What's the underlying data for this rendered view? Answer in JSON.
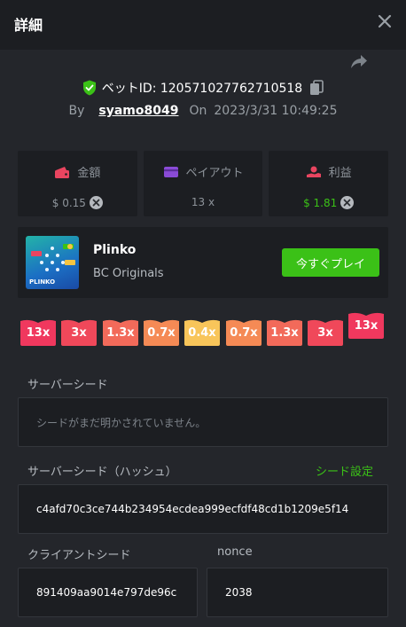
{
  "header": {
    "title": "詳細"
  },
  "bet": {
    "id_label": "ベットID: 120571027762710518",
    "by_label": "By",
    "user": "syamo8049",
    "on_label": "On",
    "date": "2023/3/31 10:49:25"
  },
  "stats": [
    {
      "label": "金額",
      "value": "$ 0.15",
      "icon": "wallet-icon",
      "color": "#e94560"
    },
    {
      "label": "ペイアウト",
      "value": "13 x",
      "icon": "card-icon",
      "color": "#8a4bd6"
    },
    {
      "label": "利益",
      "value": "$ 1.81",
      "icon": "hand-coin-icon",
      "color": "#e94560"
    }
  ],
  "game": {
    "name": "Plinko",
    "provider": "BC Originals",
    "thumb_label": "PLINKO",
    "play_label": "今すぐプレイ"
  },
  "multipliers": {
    "values": [
      "13x",
      "3x",
      "1.3x",
      "0.7x",
      "0.4x",
      "0.7x",
      "1.3x",
      "3x",
      "13x"
    ],
    "active_index": 8
  },
  "server_seed": {
    "label": "サーバーシード",
    "placeholder": "シードがまだ明かされていません。"
  },
  "server_seed_hash": {
    "label": "サーバーシード（ハッシュ）",
    "link": "シード設定",
    "value": "c4afd70c3ce744b234954ecdea999ecfdf48cd1b1209e5f14"
  },
  "client_seed": {
    "label": "クライアントシード",
    "value": "891409aa9014e797de96c"
  },
  "nonce": {
    "label": "nonce",
    "value": "2038"
  },
  "colors": {
    "accent_green": "#3bc117",
    "panel": "#1c1e22",
    "background": "#24262b"
  }
}
